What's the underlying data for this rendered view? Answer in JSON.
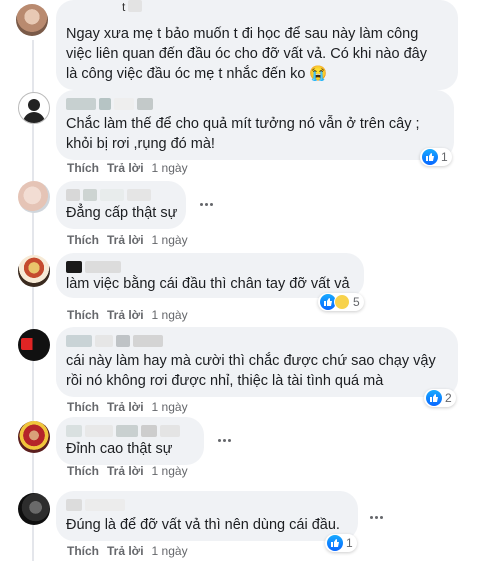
{
  "comments": [
    {
      "text_lines": [
        "Ngay xưa mẹ t bảo muốn t đi học để sau này làm công",
        "việc liên quan đến đầu óc cho đỡ vất vả. Có khi nào đây",
        "là công việc đầu óc mẹ t nhắc đến ko 😭"
      ],
      "author_partial": "t"
    },
    {
      "text_lines": [
        "Chắc làm thế để cho quả mít tưởng nó vẫn ở trên cây ;",
        "khỏi bị rơi ,rụng đó mà!"
      ],
      "like_label": "Thích",
      "reply_label": "Trả lời",
      "time": "1 ngày",
      "reactions": "1"
    },
    {
      "text_lines": [
        "Đẳng cấp thật sự"
      ],
      "like_label": "Thích",
      "reply_label": "Trả lời",
      "time": "1 ngày"
    },
    {
      "text_lines": [
        "làm việc bằng cái đầu thì chân tay đỡ vất vả"
      ],
      "like_label": "Thích",
      "reply_label": "Trả lời",
      "time": "1 ngày",
      "reactions": "5"
    },
    {
      "text_lines": [
        "cái này làm hay mà cười thì chắc được chứ sao chạy vậy",
        "rồi nó không rơi được nhỉ, thiệc là tài tình quá mà"
      ],
      "like_label": "Thích",
      "reply_label": "Trả lời",
      "time": "1 ngày",
      "reactions": "2"
    },
    {
      "text_lines": [
        "Đỉnh cao thật sự"
      ],
      "like_label": "Thích",
      "reply_label": "Trả lời",
      "time": "1 ngày"
    },
    {
      "text_lines": [
        "Đúng là để đỡ vất vả thì nên dùng cái đầu."
      ],
      "like_label": "Thích",
      "reply_label": "Trả lời",
      "time": "1 ngày",
      "reactions": "1"
    }
  ],
  "colors": {
    "bubble": "#f0f2f5",
    "like_blue": "#0866ff",
    "meta_gray": "#65676b"
  },
  "icons": {
    "like": "like-icon",
    "haha": "haha-icon",
    "more": "more-options-icon"
  }
}
